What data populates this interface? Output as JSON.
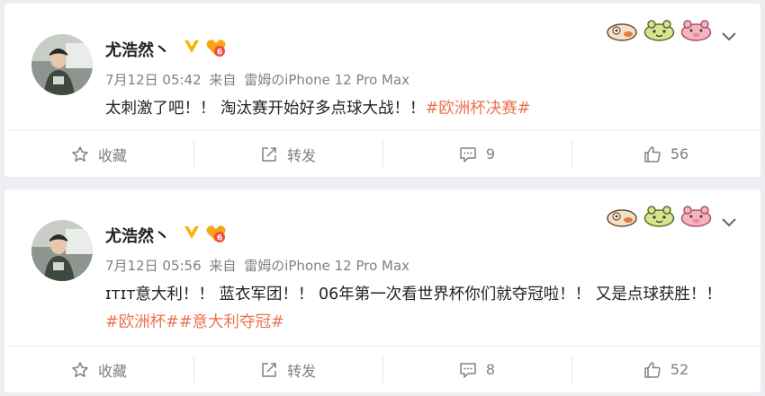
{
  "posts": [
    {
      "username": "尤浩然丶",
      "timestamp": "7月12日 05:42",
      "source_prefix": "来自",
      "source": "雷姆のiPhone 12 Pro Max",
      "text": "太刺激了吧！！ 淘汰赛开始好多点球大战！！",
      "tags": [
        "#欧洲杯决赛#"
      ],
      "actions": {
        "favorite_label": "收藏",
        "repost_label": "转发",
        "comment_count": "9",
        "like_count": "56"
      }
    },
    {
      "username": "尤浩然丶",
      "timestamp": "7月12日 05:56",
      "source_prefix": "来自",
      "source": "雷姆のiPhone 12 Pro Max",
      "text": "ɪᴛɪᴛ意大利！！ 蓝衣军团！！ 06年第一次看世界杯你们就夺冠啦！！ 又是点球获胜！！",
      "tags": [
        "#欧洲杯#",
        "#意大利夺冠#"
      ],
      "actions": {
        "favorite_label": "收藏",
        "repost_label": "转发",
        "comment_count": "8",
        "like_count": "52"
      }
    }
  ],
  "colors": {
    "background": "#eceef1",
    "tag": "#eb7350",
    "verified_badge": "#f5b400",
    "muted_text": "#808080"
  },
  "icons": {
    "verified": "v-badge-icon",
    "level": "level-badge-icon",
    "favorite": "star-icon",
    "repost": "repost-icon",
    "comment": "comment-icon",
    "like": "thumbs-up-icon",
    "menu": "chevron-down-icon"
  }
}
